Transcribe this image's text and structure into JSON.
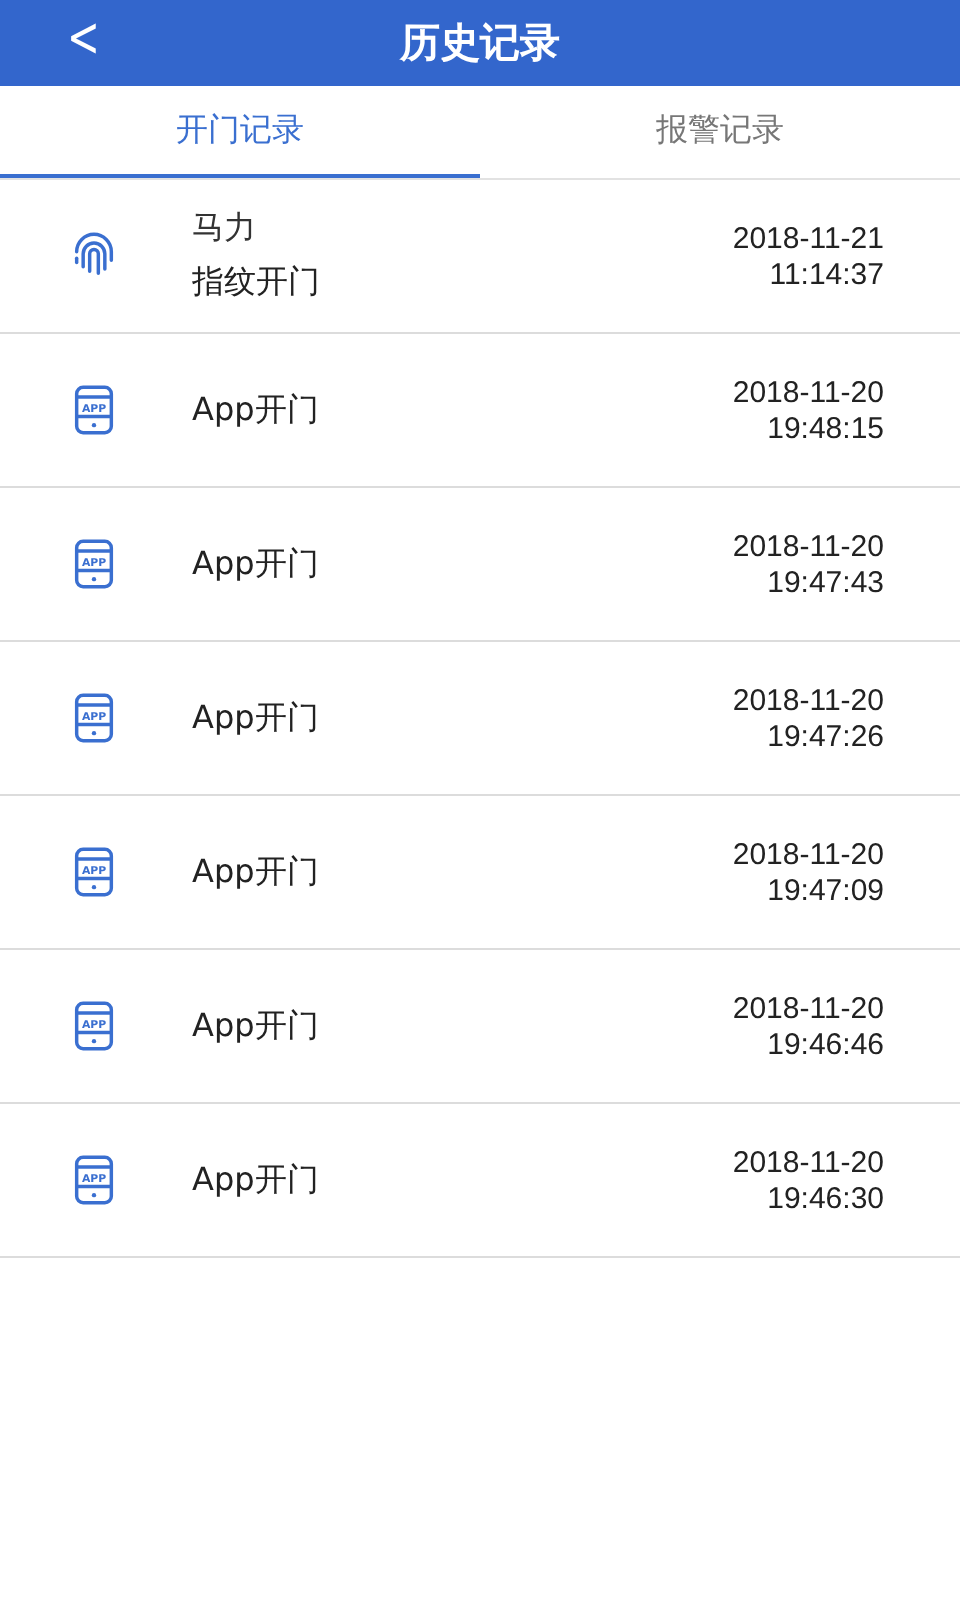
{
  "header": {
    "back": "<",
    "title": "历史记录"
  },
  "tabs": [
    {
      "label": "开门记录",
      "selected": true
    },
    {
      "label": "报警记录",
      "selected": false
    }
  ],
  "records": [
    {
      "kind": "fingerprint",
      "name": "马力",
      "action": "指纹开门",
      "date": "2018-11-21",
      "time": "11:14:37"
    },
    {
      "kind": "app",
      "icon_text": "APP",
      "action": "App开门",
      "date": "2018-11-20",
      "time": "19:48:15"
    },
    {
      "kind": "app",
      "icon_text": "APP",
      "action": "App开门",
      "date": "2018-11-20",
      "time": "19:47:43"
    },
    {
      "kind": "app",
      "icon_text": "APP",
      "action": "App开门",
      "date": "2018-11-20",
      "time": "19:47:26"
    },
    {
      "kind": "app",
      "icon_text": "APP",
      "action": "App开门",
      "date": "2018-11-20",
      "time": "19:47:09"
    },
    {
      "kind": "app",
      "icon_text": "APP",
      "action": "App开门",
      "date": "2018-11-20",
      "time": "19:46:46"
    },
    {
      "kind": "app",
      "icon_text": "APP",
      "action": "App开门",
      "date": "2018-11-20",
      "time": "19:46:30"
    }
  ]
}
